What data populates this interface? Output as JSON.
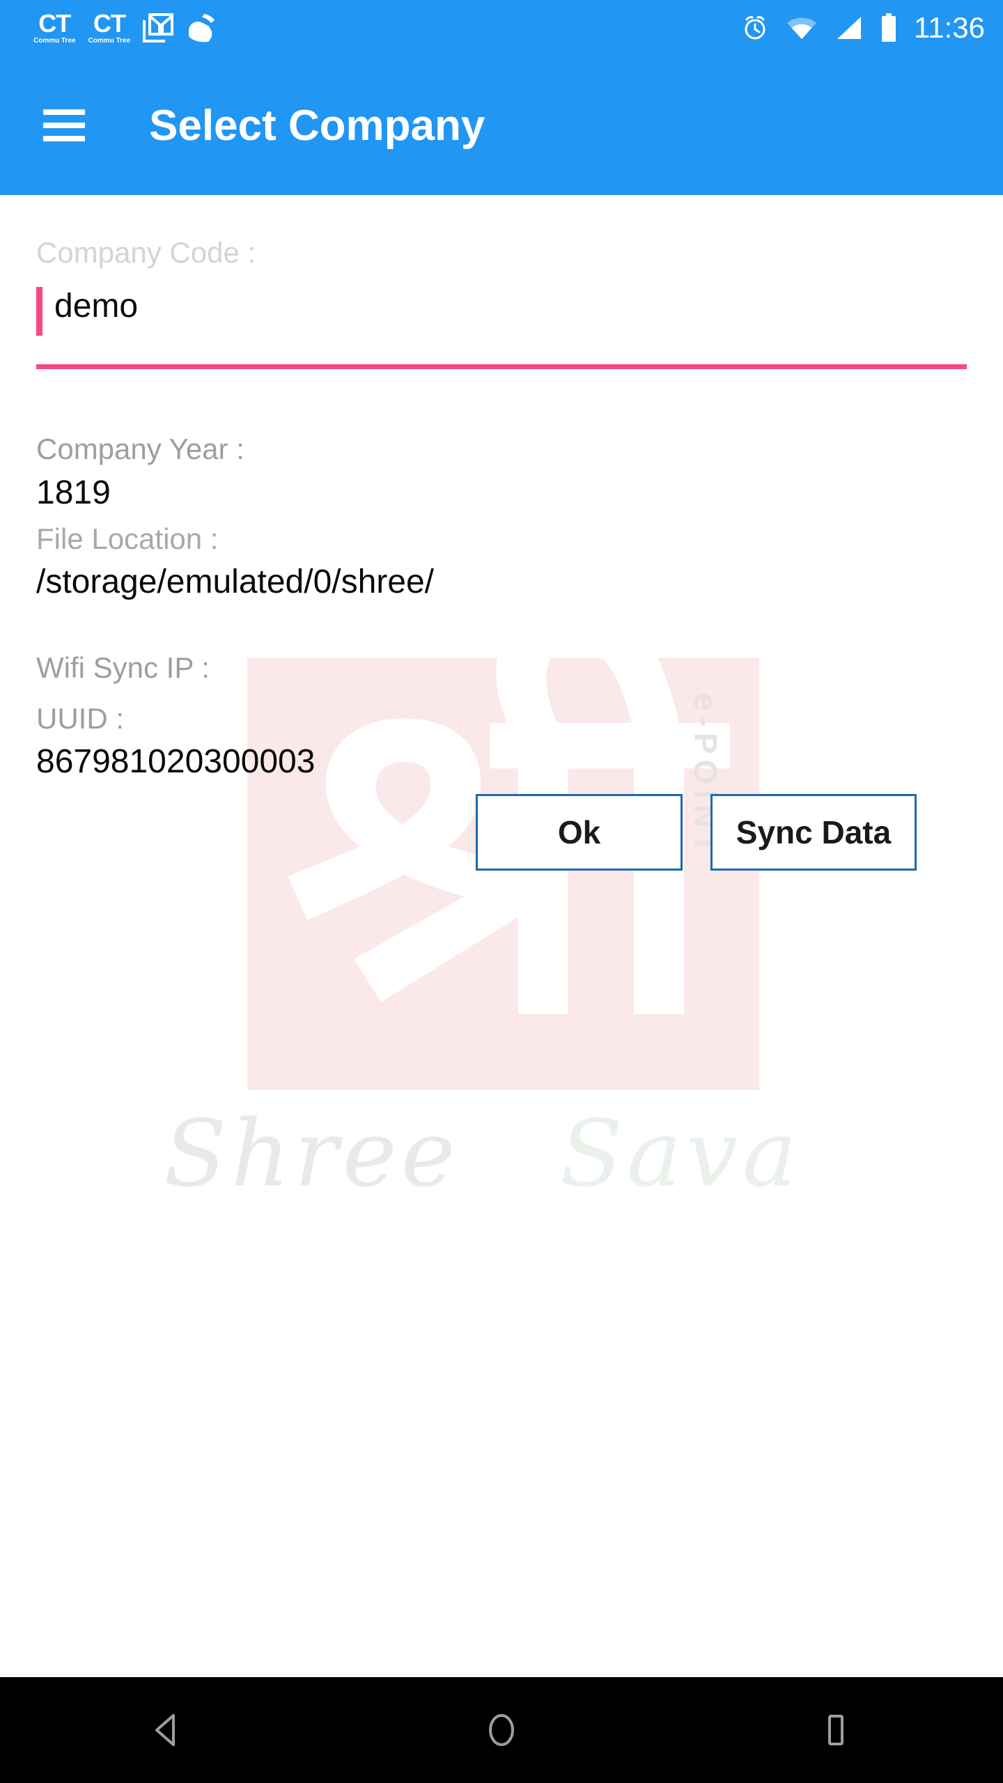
{
  "statusbar": {
    "notifications": [
      {
        "icon": "commu-tree-icon",
        "main": "CT",
        "sub": "Commu Tree"
      },
      {
        "icon": "commu-tree-icon",
        "main": "CT",
        "sub": "Commu Tree"
      },
      {
        "icon": "gmail-icon"
      },
      {
        "icon": "cleaner-broom-icon"
      }
    ],
    "alarm_icon": "alarm-clock-icon",
    "wifi_icon": "wifi-icon",
    "signal_icon": "cellular-signal-icon",
    "battery_icon": "battery-full-icon",
    "time": "11:36"
  },
  "appbar": {
    "menu_icon": "hamburger-menu-icon",
    "title": "Select Company",
    "background": "#2196f3"
  },
  "form": {
    "company_code": {
      "label": "Company Code :",
      "value": "demo",
      "accent": "#f54a80"
    },
    "company_year": {
      "label": "Company Year :",
      "value": "1819"
    },
    "file_location": {
      "label": "File Location :",
      "value": "/storage/emulated/0/shree/"
    },
    "wifi_sync_ip": {
      "label": "Wifi Sync IP :",
      "value": ""
    },
    "uuid": {
      "label": "UUID :",
      "value": "867981020300003"
    }
  },
  "buttons": {
    "ok": "Ok",
    "sync": "Sync Data",
    "border_color": "#1b6ca8"
  },
  "watermark": {
    "glyph": "श्री",
    "brand_vertical": "e-POINT",
    "brand_text_1": "Shree",
    "brand_text_2": "Sava",
    "box_color": "#fbe8e9"
  },
  "navbar": {
    "back_icon": "back-triangle-icon",
    "home_icon": "home-circle-icon",
    "recents_icon": "recents-square-icon"
  }
}
